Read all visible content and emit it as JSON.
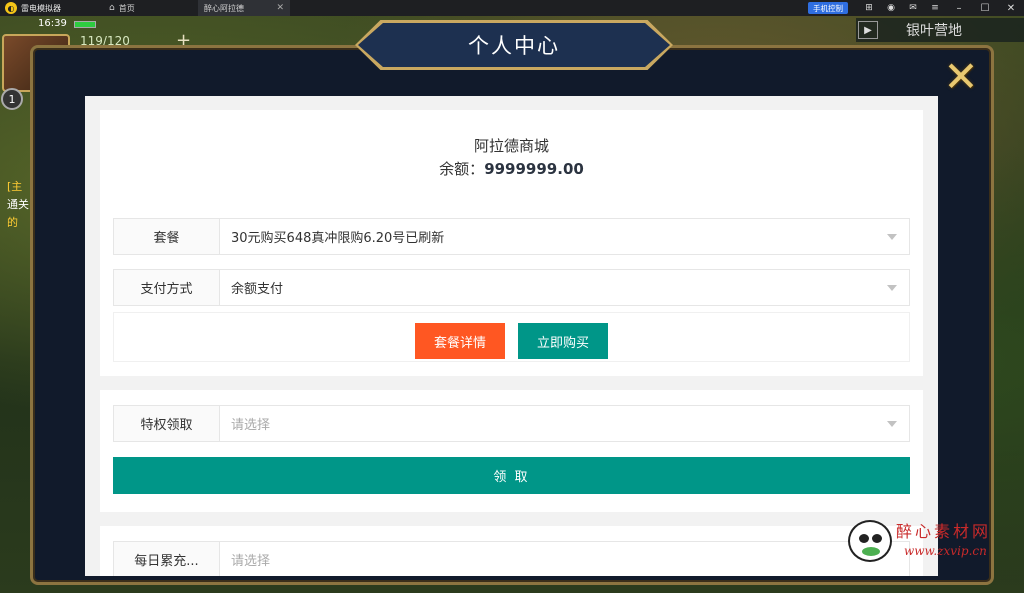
{
  "titlebar": {
    "app_name": "雷电模拟器",
    "tabs": [
      {
        "label": "首页"
      },
      {
        "label": "醉心阿拉德"
      }
    ],
    "phone_control": "手机控制"
  },
  "game_hud": {
    "time": "16:39",
    "energy": "119/120",
    "plus": "+",
    "round_badge": "1",
    "side_texts": [
      "[主",
      "通关",
      "的"
    ],
    "location": "银叶营地"
  },
  "dialog": {
    "title": "个人中心",
    "close_glyph": "✕"
  },
  "shop": {
    "name": "阿拉德商城",
    "balance_label": "余额：",
    "balance_value": "9999999.00"
  },
  "form": {
    "package": {
      "label": "套餐",
      "value": "30元购买648真冲限购6.20号已刷新"
    },
    "payment": {
      "label": "支付方式",
      "value": "余额支付"
    },
    "details_button": "套餐详情",
    "buy_button": "立即购买",
    "privilege": {
      "label": "特权领取",
      "placeholder": "请选择"
    },
    "claim_button": "领 取",
    "daily": {
      "label": "每日累充...",
      "placeholder": "请选择"
    }
  },
  "watermark": {
    "text": "醉心素材网",
    "url": "www.zxvip.cn"
  },
  "colors": {
    "orange": "#ff5722",
    "teal": "#009688",
    "frame_gold": "#c9a860",
    "frame_bg": "#111a2b"
  }
}
